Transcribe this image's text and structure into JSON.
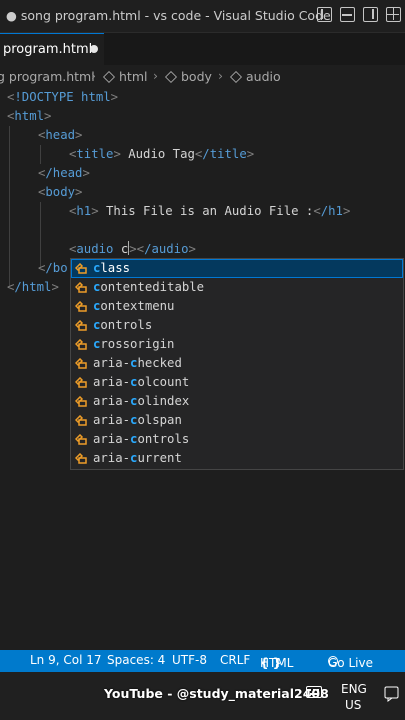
{
  "window": {
    "title": "● song program.html - vs code - Visual Studio Code"
  },
  "tab": {
    "label": "program.html"
  },
  "breadcrumb": {
    "file": "g program.html",
    "html": "html",
    "body": "body",
    "audio": "audio"
  },
  "code": {
    "l1_doctype": "!DOCTYPE",
    "l1_html": "html",
    "l2": "html",
    "l3": "head",
    "l4_tag_open": "title",
    "l4_text": " Audio Tag",
    "l4_tag_close": "/title",
    "l5": "/head",
    "l6": "body",
    "l7_tag_open": "h1",
    "l7_text": " This File is an Audio File :",
    "l7_tag_close": "/h1",
    "l9_tag": "audio",
    "l9_typed": " c",
    "l9_close": "/audio",
    "l10": "/bo",
    "l11": "/html"
  },
  "suggestions": [
    {
      "match": "c",
      "rest": "lass"
    },
    {
      "match": "c",
      "rest": "ontenteditable"
    },
    {
      "match": "c",
      "rest": "ontextmenu"
    },
    {
      "match": "c",
      "rest": "ontrols"
    },
    {
      "match": "c",
      "rest": "rossorigin"
    },
    {
      "pre": "aria-",
      "match": "c",
      "rest": "hecked"
    },
    {
      "pre": "aria-",
      "match": "c",
      "rest": "olcount"
    },
    {
      "pre": "aria-",
      "match": "c",
      "rest": "olindex"
    },
    {
      "pre": "aria-",
      "match": "c",
      "rest": "olspan"
    },
    {
      "pre": "aria-",
      "match": "c",
      "rest": "ontrols"
    },
    {
      "pre": "aria-",
      "match": "c",
      "rest": "urrent"
    }
  ],
  "status": {
    "position": "Ln 9, Col 17",
    "spaces": "Spaces: 4",
    "encoding": "UTF-8",
    "eol": "CRLF",
    "language": "HTML",
    "golive": "Go Live",
    "lang_braces": "{ }"
  },
  "taskbar": {
    "watermark": "YouTube - @study_material2408",
    "lang_top": "ENG",
    "lang_bottom": "US"
  },
  "colors": {
    "accent": "#007acc",
    "keyword": "#569cd6",
    "highlight": "#2aaaff"
  },
  "icons": [
    "layout-sidebar-left-icon",
    "layout-panel-icon",
    "layout-sidebar-right-icon",
    "customize-layout-icon",
    "symbol-property-icon",
    "go-live-icon",
    "keyboard-icon",
    "notification-icon"
  ]
}
